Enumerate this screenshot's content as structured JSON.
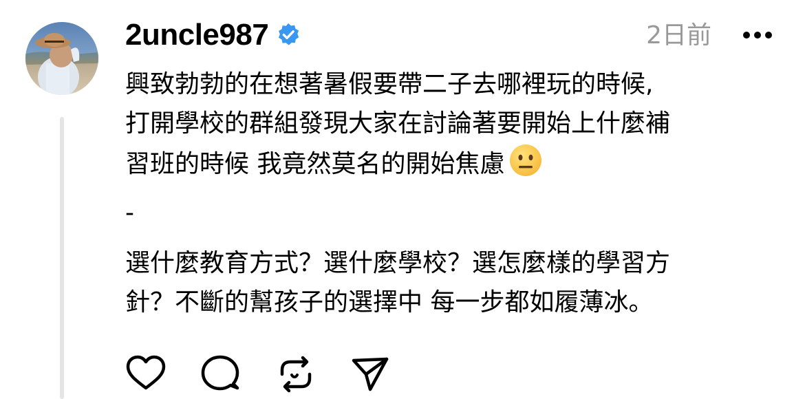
{
  "post": {
    "username": "2uncle987",
    "verified": true,
    "timestamp": "2日前",
    "body_lines": [
      "興致勃勃的在想著暑假要帶二子去哪裡玩的時候,",
      "打開學校的群組發現大家在討論著要開始上什麼補",
      "習班的時候 我竟然莫名的開始焦慮",
      "-",
      "選什麼教育方式？選什麼學校？選怎麼樣的學習方",
      "針？不斷的幫孩子的選擇中 每一步都如履薄冰。"
    ],
    "emoji": "neutral-face-emoji"
  },
  "icons": {
    "verified": "verified-badge-icon",
    "more": "more-options-icon",
    "like": "heart-icon",
    "comment": "comment-icon",
    "repost": "repost-icon",
    "share": "send-icon"
  },
  "colors": {
    "verified_blue": "#3897f0",
    "timestamp_gray": "#999999",
    "thread_line": "#e5e5e5"
  }
}
